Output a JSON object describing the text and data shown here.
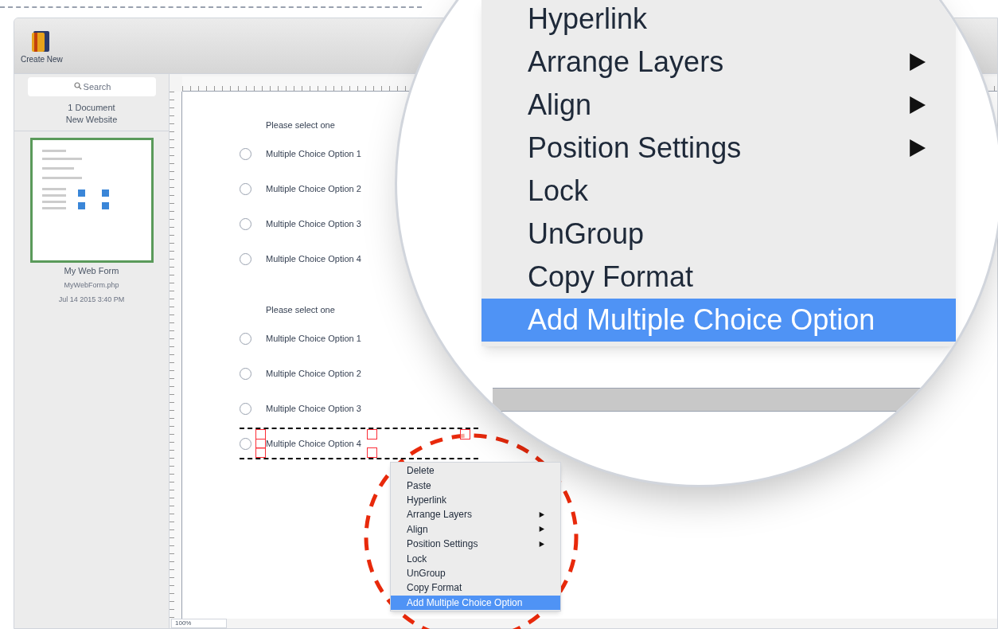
{
  "toolbar": {
    "create_button": "Create New"
  },
  "sidebar": {
    "search": {
      "placeholder": "Search"
    },
    "summary": [
      "1 Document",
      "New Website"
    ],
    "documents": [
      {
        "title": "My Web Form",
        "file": "MyWebForm.php",
        "date": "Jul 14 2015 3:40 PM",
        "selected": true
      }
    ]
  },
  "canvas": {
    "groups": [
      {
        "title": "Please select one",
        "options": [
          {
            "label": "Multiple Choice Option 1",
            "checked": false,
            "selected": false
          },
          {
            "label": "Multiple Choice Option 2",
            "checked": false,
            "selected": false
          },
          {
            "label": "Multiple Choice Option 3",
            "checked": false,
            "selected": false
          },
          {
            "label": "Multiple Choice Option 4",
            "checked": false,
            "selected": false
          }
        ]
      },
      {
        "title": "Please select one",
        "options": [
          {
            "label": "Multiple Choice Option 1",
            "checked": false,
            "selected": false
          },
          {
            "label": "Multiple Choice Option 2",
            "checked": false,
            "selected": false
          },
          {
            "label": "Multiple Choice Option 3",
            "checked": false,
            "selected": false
          },
          {
            "label": "Multiple Choice Option 4",
            "checked": false,
            "selected": true
          }
        ]
      }
    ],
    "zoom": "100%"
  },
  "context_menu": {
    "items": [
      {
        "label": "Delete",
        "submenu": false,
        "selected": false
      },
      {
        "label": "Paste",
        "submenu": false,
        "selected": false
      },
      {
        "label": "Hyperlink",
        "submenu": false,
        "selected": false
      },
      {
        "label": "Arrange Layers",
        "submenu": true,
        "selected": false
      },
      {
        "label": "Align",
        "submenu": true,
        "selected": false
      },
      {
        "label": "Position Settings",
        "submenu": true,
        "selected": false
      },
      {
        "label": "Lock",
        "submenu": false,
        "selected": false
      },
      {
        "label": "UnGroup",
        "submenu": false,
        "selected": false
      },
      {
        "label": "Copy Format",
        "submenu": false,
        "selected": false
      },
      {
        "label": "Add Multiple Choice Option",
        "submenu": false,
        "selected": true
      }
    ]
  },
  "magnified_menu": {
    "items": [
      {
        "label": "Hyperlink",
        "submenu": false,
        "selected": false
      },
      {
        "label": "Arrange Layers",
        "submenu": true,
        "selected": false
      },
      {
        "label": "Align",
        "submenu": true,
        "selected": false
      },
      {
        "label": "Position Settings",
        "submenu": true,
        "selected": false
      },
      {
        "label": "Lock",
        "submenu": false,
        "selected": false
      },
      {
        "label": "UnGroup",
        "submenu": false,
        "selected": false
      },
      {
        "label": "Copy Format",
        "submenu": false,
        "selected": false
      },
      {
        "label": "Add Multiple Choice Option",
        "submenu": false,
        "selected": true
      }
    ]
  }
}
